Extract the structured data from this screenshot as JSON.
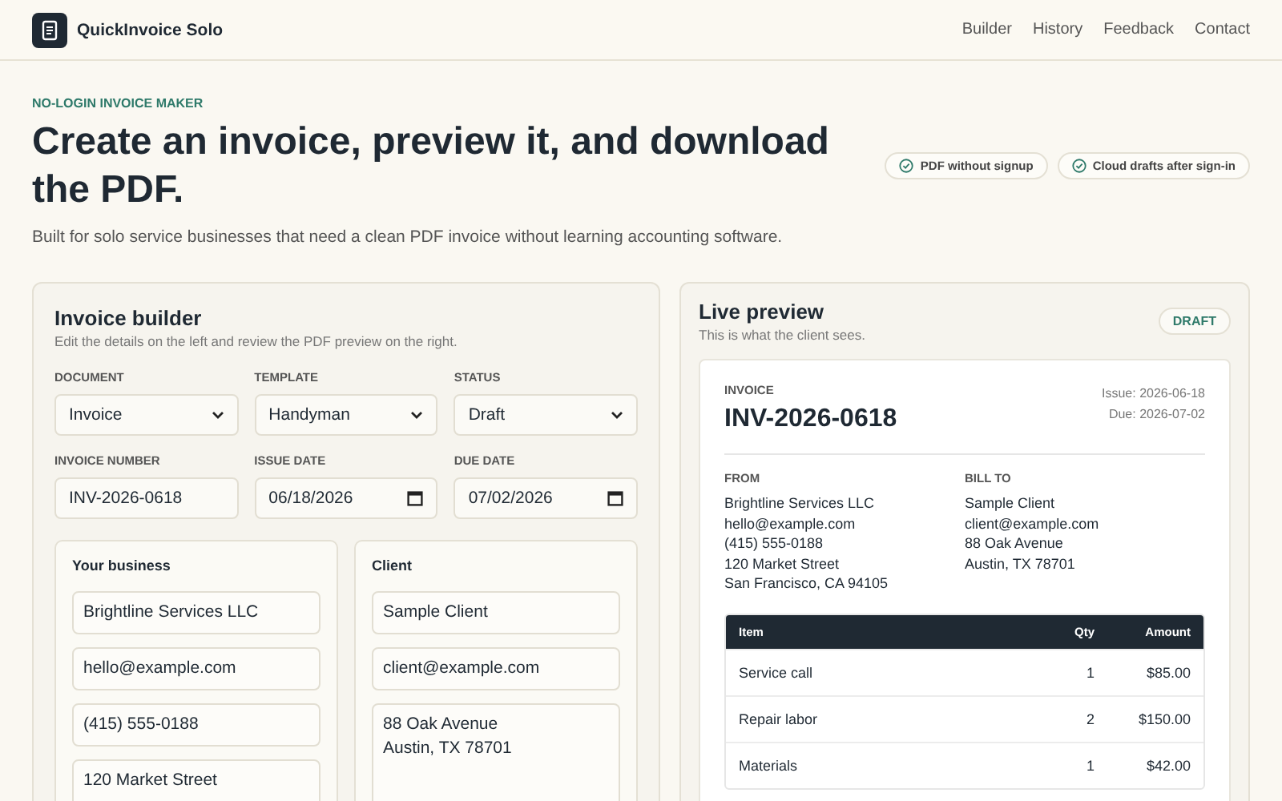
{
  "brand": {
    "name": "QuickInvoice Solo"
  },
  "nav": [
    {
      "label": "Builder"
    },
    {
      "label": "History"
    },
    {
      "label": "Feedback"
    },
    {
      "label": "Contact"
    }
  ],
  "hero": {
    "eyebrow": "NO-LOGIN INVOICE MAKER",
    "title": "Create an invoice, preview it, and download the PDF.",
    "subtitle": "Built for solo service businesses that need a clean PDF invoice without learning accounting software.",
    "badges": [
      {
        "label": "PDF without signup"
      },
      {
        "label": "Cloud drafts after sign-in"
      }
    ]
  },
  "builder": {
    "title": "Invoice builder",
    "subtitle": "Edit the details on the left and review the PDF preview on the right.",
    "fields": [
      {
        "kind": "select",
        "label": "DOCUMENT",
        "value": "Invoice"
      },
      {
        "kind": "select",
        "label": "TEMPLATE",
        "value": "Handyman"
      },
      {
        "kind": "select",
        "label": "STATUS",
        "value": "Draft"
      },
      {
        "kind": "text",
        "label": "INVOICE NUMBER",
        "value": "INV-2026-0618"
      },
      {
        "kind": "date",
        "label": "ISSUE DATE",
        "value": "06/18/2026"
      },
      {
        "kind": "date",
        "label": "DUE DATE",
        "value": "07/02/2026"
      }
    ],
    "parties": [
      {
        "title": "Your business",
        "inputs": [
          {
            "kind": "text",
            "value": "Brightline Services LLC"
          },
          {
            "kind": "text",
            "value": "hello@example.com"
          },
          {
            "kind": "text",
            "value": "(415) 555-0188"
          },
          {
            "kind": "textarea",
            "value": "120 Market Street"
          }
        ]
      },
      {
        "title": "Client",
        "inputs": [
          {
            "kind": "text",
            "value": "Sample Client"
          },
          {
            "kind": "text",
            "value": "client@example.com"
          },
          {
            "kind": "textarea",
            "value": "88 Oak Avenue\nAustin, TX 78701"
          }
        ]
      }
    ]
  },
  "preview": {
    "title": "Live preview",
    "subtitle": "This is what the client sees.",
    "status_badge": "DRAFT",
    "doc_label": "INVOICE",
    "number": "INV-2026-0618",
    "issue": "Issue: 2026-06-18",
    "due": "Due: 2026-07-02",
    "from": {
      "label": "FROM",
      "lines": [
        "Brightline Services LLC",
        "hello@example.com",
        "(415) 555-0188",
        "120 Market Street",
        "San Francisco, CA 94105"
      ]
    },
    "bill_to": {
      "label": "BILL TO",
      "lines": [
        "Sample Client",
        "client@example.com",
        "88 Oak Avenue",
        "Austin, TX 78701"
      ]
    },
    "table": {
      "columns": [
        "Item",
        "Qty",
        "Amount"
      ],
      "rows": [
        [
          "Service call",
          "1",
          "$85.00"
        ],
        [
          "Repair labor",
          "2",
          "$150.00"
        ],
        [
          "Materials",
          "1",
          "$42.00"
        ]
      ]
    }
  }
}
